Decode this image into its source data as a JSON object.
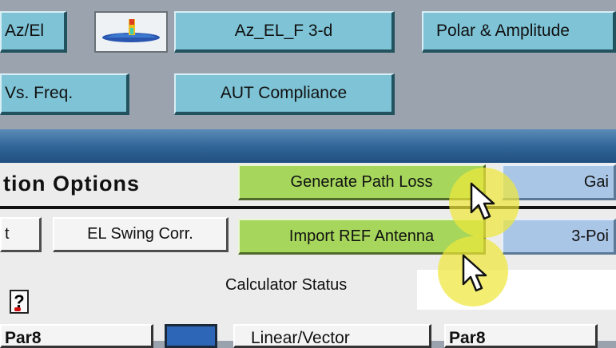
{
  "toolbar": {
    "az_el_label": "Az/El",
    "plot3d_icon": "surface-plot-icon",
    "az_el_f_label": "Az_EL_F 3-d",
    "polar_amp_label": "Polar & Amplitude",
    "vs_freq_label": "Vs. Freq.",
    "aut_compliance_label": "AUT Compliance"
  },
  "panel": {
    "title": "tion Options",
    "generate_path_loss_label": "Generate Path Loss",
    "gain_label": "Gai",
    "t_label": "t",
    "el_swing_label": "EL Swing Corr.",
    "import_ref_label": "Import REF Antenna",
    "three_point_label": "3-Poi",
    "help_label": "?",
    "calculator_status_label": "Calculator Status",
    "calculator_status_value": ""
  },
  "bottom": {
    "btn1_label": "Par8",
    "btn3_label": "Linear/Vector",
    "btn4_label": "Par8"
  },
  "colors": {
    "toolbar_button": "#7ec3d6",
    "green_button": "#a6d65c",
    "blue_button": "#aac6e6",
    "highlight": "#eee83c"
  }
}
